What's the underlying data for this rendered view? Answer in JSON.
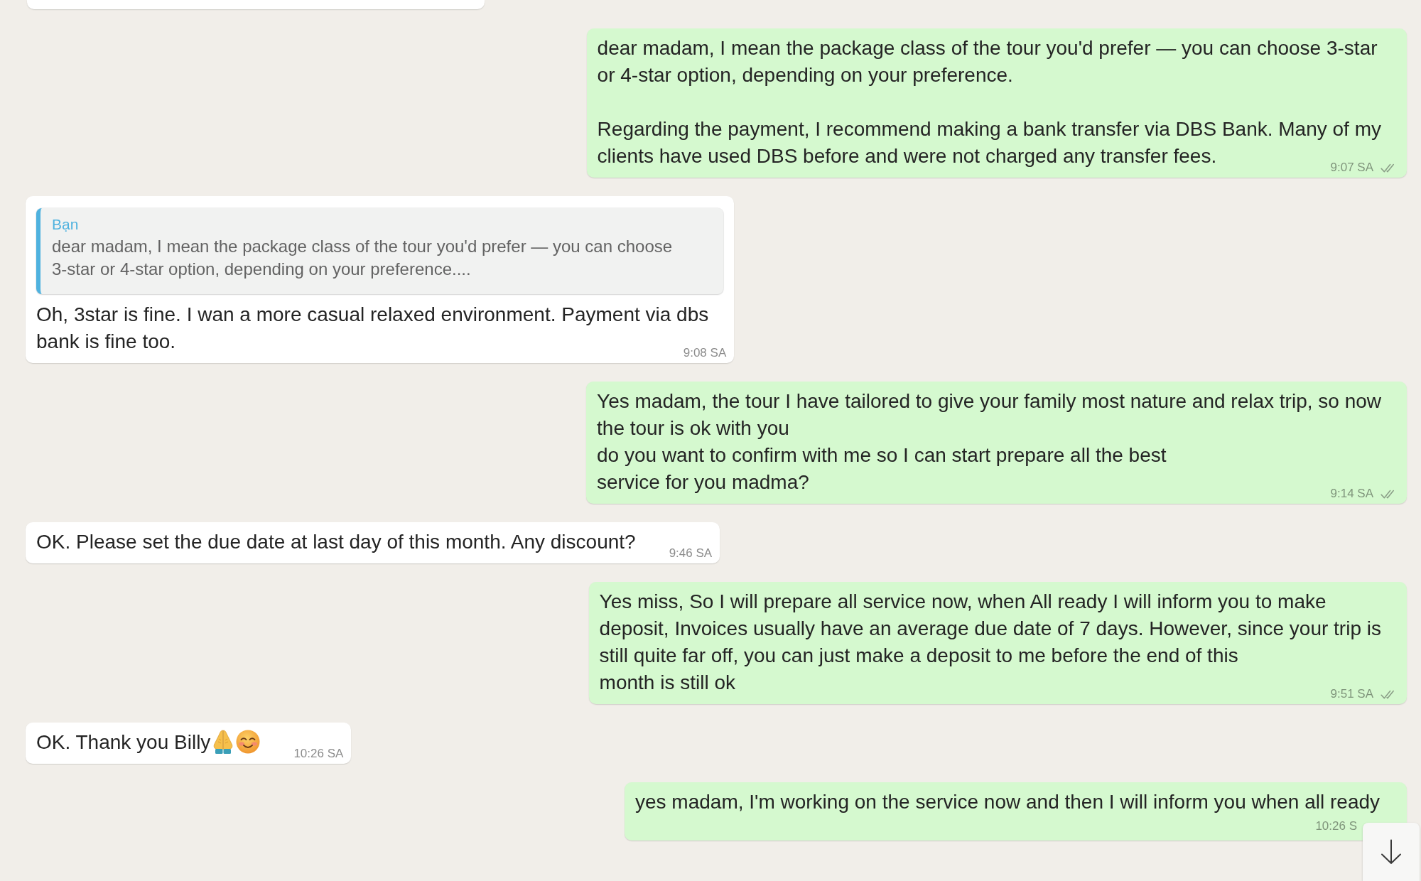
{
  "messages": [
    {
      "outgoing": false,
      "cut_off": true
    },
    {
      "outgoing": true,
      "text": "dear madam, I mean the package class of the tour you'd prefer — you can choose 3-star\nor 4-star option, depending on your preference.\n\nRegarding the payment, I recommend making a bank transfer via DBS Bank. Many of my\nclients have used DBS before and were not charged any transfer fees.",
      "time": "9:07 SA",
      "read": false
    },
    {
      "outgoing": false,
      "quote": {
        "author": "Bạn",
        "text": "dear madam, I mean the package class of the tour you'd prefer — you can choose\n3-star or 4-star option, depending on your preference...."
      },
      "text": "Oh, 3star is fine. I wan a more casual relaxed environment. Payment via dbs\nbank is fine too.",
      "time": "9:08 SA"
    },
    {
      "outgoing": true,
      "text": "Yes madam, the tour I have tailored to give your family most nature and relax trip, so now\nthe tour is ok with you\ndo you want to confirm with me so I can start prepare all the best\nservice for you madma?",
      "time": "9:14 SA",
      "read": false
    },
    {
      "outgoing": false,
      "text": "OK. Please set the due date at last day of this month. Any discount?",
      "time": "9:46 SA"
    },
    {
      "outgoing": true,
      "text": "Yes miss, So I will prepare all service now, when All ready I will inform you to make\ndeposit, Invoices usually have an average due date of 7 days. However, since your trip is\nstill quite far off, you can just make a deposit to me before the end of this\nmonth is still ok",
      "time": "9:51 SA",
      "read": false
    },
    {
      "outgoing": false,
      "text": "OK. Thank you Billy",
      "emojis": [
        {
          "kind": "folded-hands"
        },
        {
          "kind": "smiling-face"
        }
      ],
      "time": "10:26 SA"
    },
    {
      "outgoing": true,
      "text": "yes madam, I'm working on the service now and then I will inform you when all ready",
      "time": "10:26 S"
    }
  ],
  "scroll_down_button": true
}
